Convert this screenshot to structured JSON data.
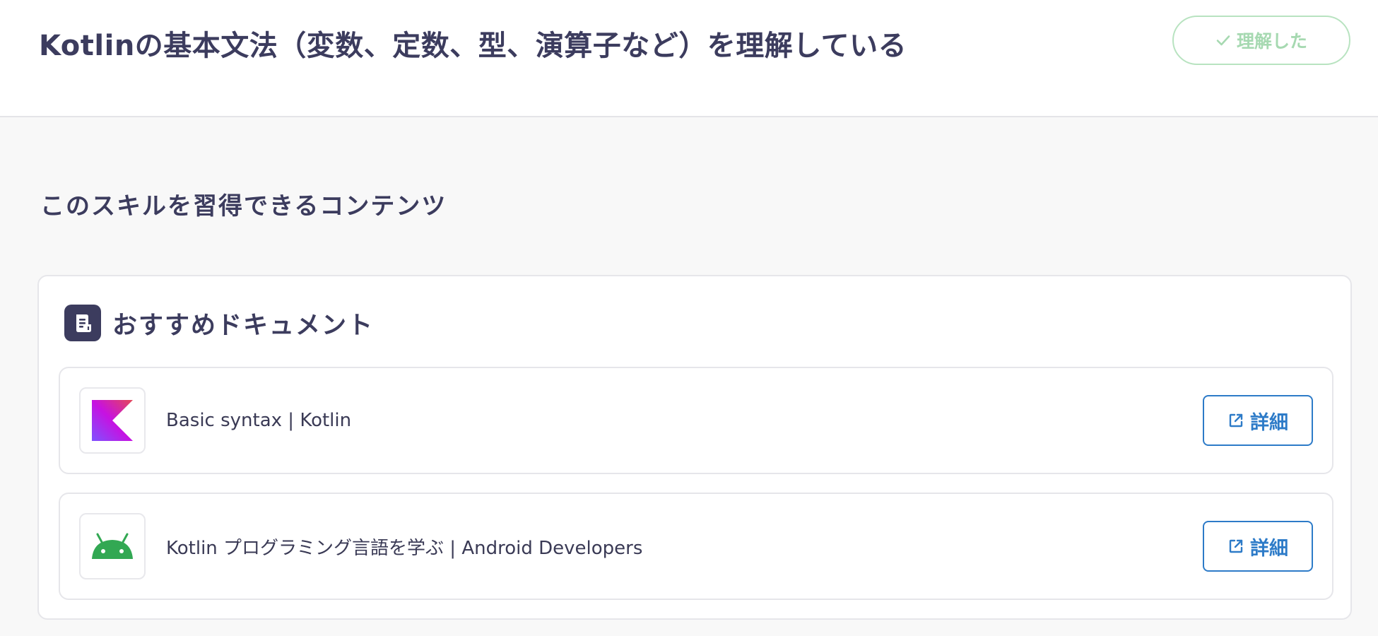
{
  "header": {
    "title": "Kotlinの基本文法（変数、定数、型、演算子など）を理解している",
    "understood_button": {
      "label": "理解した",
      "icon": "check-icon",
      "color": "#a6d9b1"
    }
  },
  "section": {
    "title": "このスキルを習得できるコンテンツ"
  },
  "card": {
    "title": "おすすめドキュメント",
    "icon": "document-icon",
    "items": [
      {
        "label": "Basic syntax | Kotlin",
        "thumbnail": "kotlin-logo",
        "button_label": "詳細",
        "button_icon": "external-link-icon"
      },
      {
        "label": "Kotlin プログラミング言語を学ぶ | Android Developers",
        "thumbnail": "android-logo",
        "button_label": "詳細",
        "button_icon": "external-link-icon"
      }
    ]
  },
  "colors": {
    "accent": "#2d7bc8",
    "text": "#3c3c5e",
    "background": "#f8f8f8"
  }
}
